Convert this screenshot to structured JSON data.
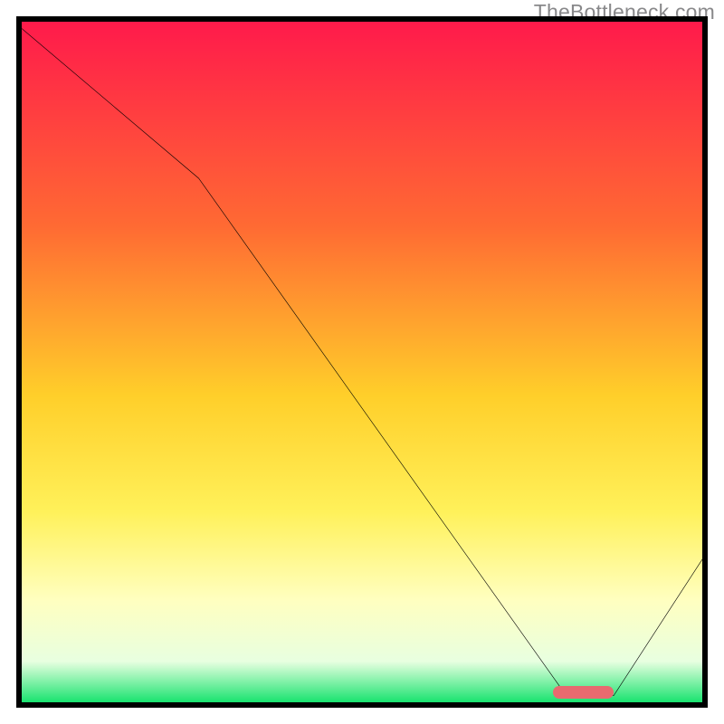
{
  "watermark": "TheBottleneck.com",
  "chart_data": {
    "type": "line",
    "title": "",
    "xlabel": "",
    "ylabel": "",
    "xlim": [
      0,
      100
    ],
    "ylim": [
      0,
      100
    ],
    "x": [
      0,
      26,
      80,
      87,
      100
    ],
    "values": [
      99,
      77,
      1,
      1,
      21
    ],
    "marker_x_range": [
      78,
      87
    ],
    "gradient_stops": [
      {
        "pos": 0,
        "color": "#ff1a4b"
      },
      {
        "pos": 30,
        "color": "#ff6a33"
      },
      {
        "pos": 55,
        "color": "#ffcf2a"
      },
      {
        "pos": 72,
        "color": "#fff15a"
      },
      {
        "pos": 85,
        "color": "#ffffc0"
      },
      {
        "pos": 94,
        "color": "#e8ffe0"
      },
      {
        "pos": 100,
        "color": "#19e36f"
      }
    ]
  }
}
